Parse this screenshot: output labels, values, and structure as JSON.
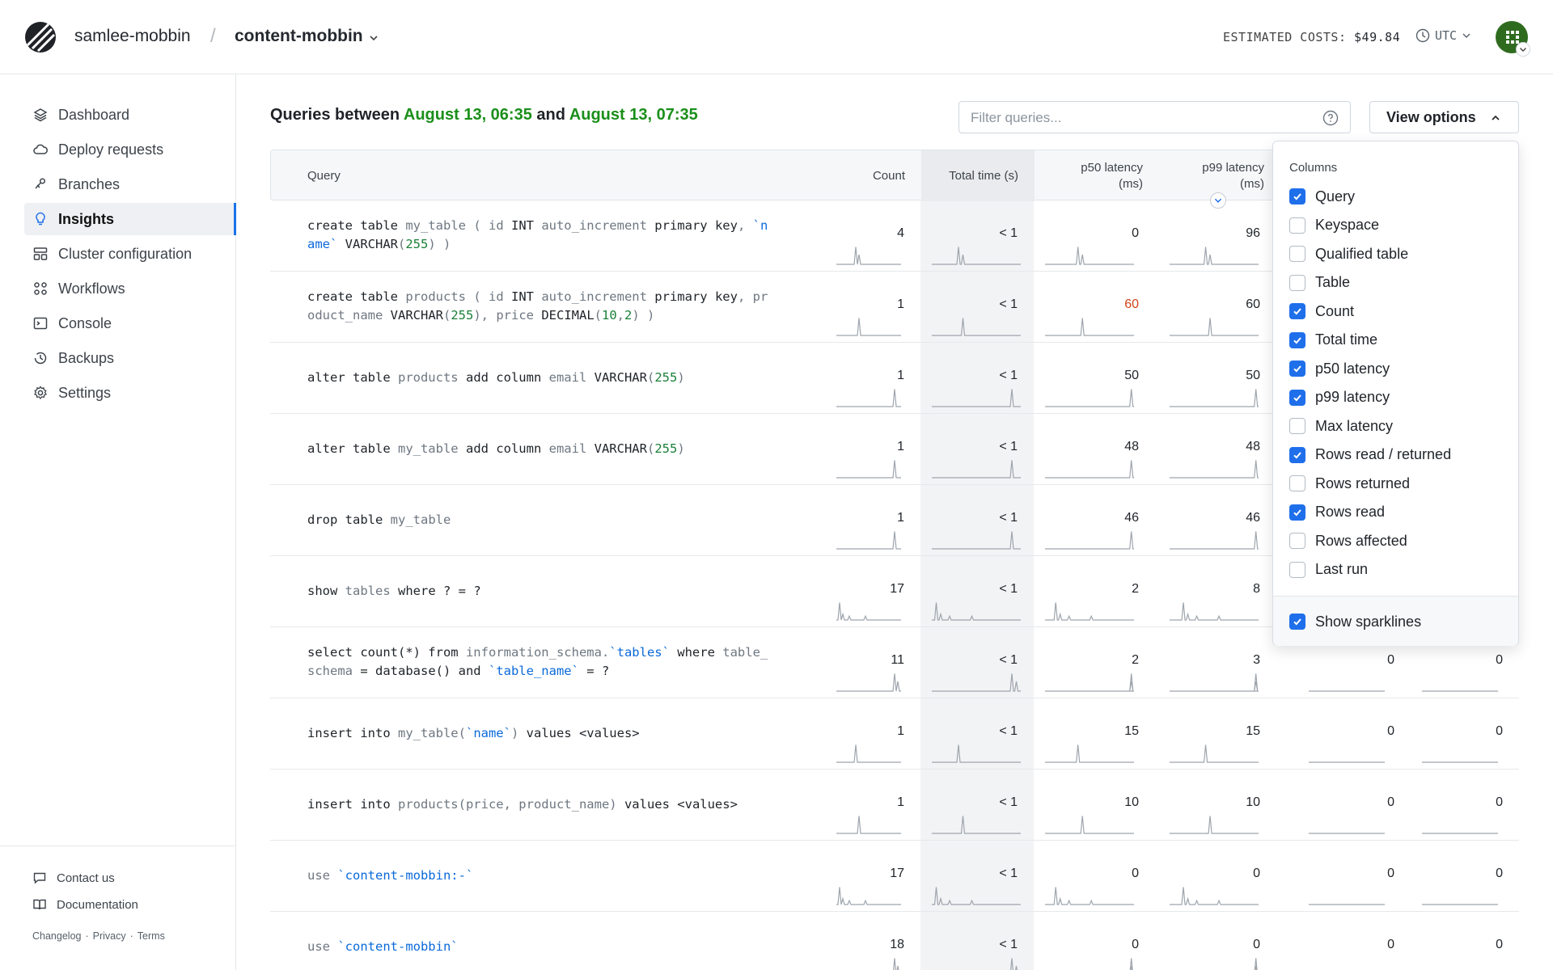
{
  "header": {
    "org": "samlee-mobbin",
    "database": "content-mobbin",
    "costs_label": "ESTIMATED COSTS:",
    "costs_value": "$49.84",
    "timezone": "UTC"
  },
  "sidebar": {
    "items": [
      {
        "label": "Dashboard",
        "icon": "layers-icon"
      },
      {
        "label": "Deploy requests",
        "icon": "cloud-icon"
      },
      {
        "label": "Branches",
        "icon": "branch-icon"
      },
      {
        "label": "Insights",
        "icon": "lightbulb-icon",
        "active": true
      },
      {
        "label": "Cluster configuration",
        "icon": "cluster-icon"
      },
      {
        "label": "Workflows",
        "icon": "workflow-icon"
      },
      {
        "label": "Console",
        "icon": "terminal-icon"
      },
      {
        "label": "Backups",
        "icon": "clock-icon"
      },
      {
        "label": "Settings",
        "icon": "gear-icon"
      }
    ],
    "footer": {
      "contact": "Contact us",
      "docs": "Documentation",
      "changelog": "Changelog",
      "privacy": "Privacy",
      "terms": "Terms"
    }
  },
  "main": {
    "title_prefix": "Queries between",
    "start": "August 13, 06:35",
    "title_and": "and",
    "end": "August 13, 07:35",
    "filter_placeholder": "Filter queries...",
    "view_options": "View options"
  },
  "table": {
    "headers": {
      "query": "Query",
      "count": "Count",
      "total_time": "Total time (s)",
      "p50": "p50 latency",
      "p50_unit": "(ms)",
      "p99": "p99 latency",
      "p99_unit": "(ms)"
    },
    "rows": [
      {
        "count": "4",
        "total": "< 1",
        "p50": "0",
        "p99": "96",
        "c5": "",
        "c6": ""
      },
      {
        "count": "1",
        "total": "< 1",
        "p50": "60",
        "p99": "60",
        "c5": "",
        "c6": "",
        "p50_warn": true
      },
      {
        "count": "1",
        "total": "< 1",
        "p50": "50",
        "p99": "50",
        "c5": "",
        "c6": ""
      },
      {
        "count": "1",
        "total": "< 1",
        "p50": "48",
        "p99": "48",
        "c5": "",
        "c6": ""
      },
      {
        "count": "1",
        "total": "< 1",
        "p50": "46",
        "p99": "46",
        "c5": "",
        "c6": ""
      },
      {
        "count": "17",
        "total": "< 1",
        "p50": "2",
        "p99": "8",
        "c5": "",
        "c6": ""
      },
      {
        "count": "11",
        "total": "< 1",
        "p50": "2",
        "p99": "3",
        "c5": "0",
        "c6": "0"
      },
      {
        "count": "1",
        "total": "< 1",
        "p50": "15",
        "p99": "15",
        "c5": "0",
        "c6": "0"
      },
      {
        "count": "1",
        "total": "< 1",
        "p50": "10",
        "p99": "10",
        "c5": "0",
        "c6": "0"
      },
      {
        "count": "17",
        "total": "< 1",
        "p50": "0",
        "p99": "0",
        "c5": "0",
        "c6": "0"
      },
      {
        "count": "18",
        "total": "< 1",
        "p50": "0",
        "p99": "0",
        "c5": "0",
        "c6": "0"
      }
    ]
  },
  "view_options": {
    "columns_label": "Columns",
    "options": [
      {
        "label": "Query",
        "checked": true
      },
      {
        "label": "Keyspace",
        "checked": false
      },
      {
        "label": "Qualified table",
        "checked": false
      },
      {
        "label": "Table",
        "checked": false
      },
      {
        "label": "Count",
        "checked": true
      },
      {
        "label": "Total time",
        "checked": true
      },
      {
        "label": "p50 latency",
        "checked": true
      },
      {
        "label": "p99 latency",
        "checked": true
      },
      {
        "label": "Max latency",
        "checked": false
      },
      {
        "label": "Rows read / returned",
        "checked": true
      },
      {
        "label": "Rows returned",
        "checked": false
      },
      {
        "label": "Rows read",
        "checked": true
      },
      {
        "label": "Rows affected",
        "checked": false
      },
      {
        "label": "Last run",
        "checked": false
      }
    ],
    "sparklines_label": "Show sparklines",
    "sparklines_checked": true
  },
  "colors": {
    "accent": "#1f6feb",
    "green": "#1a8f1a",
    "warn": "#d1421a"
  }
}
